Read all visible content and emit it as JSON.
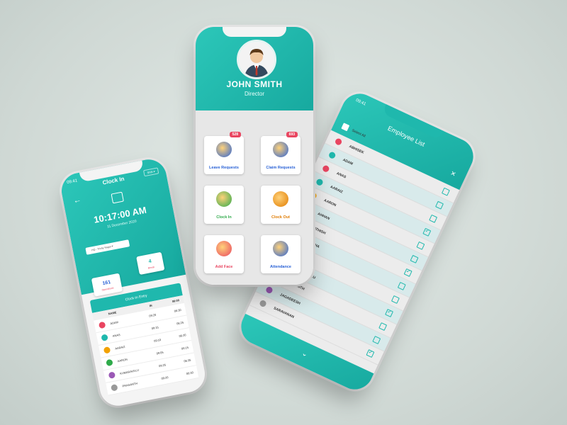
{
  "center_phone": {
    "profile_name": "JOHN SMITH",
    "profile_role": "Director",
    "tiles": [
      {
        "label": "Leave Requests",
        "badge": "528",
        "color": "#2a62d6",
        "icon": "leave-request-icon"
      },
      {
        "label": "Claim Requests",
        "badge": "693",
        "color": "#2a62d6",
        "icon": "claim-request-icon"
      },
      {
        "label": "Clock In",
        "badge": "",
        "color": "#2eaa4a",
        "icon": "clock-in-icon"
      },
      {
        "label": "Clock Out",
        "badge": "",
        "color": "#e07b00",
        "icon": "clock-out-icon"
      },
      {
        "label": "Add Face",
        "badge": "",
        "color": "#e94560",
        "icon": "add-face-icon"
      },
      {
        "label": "Attendance",
        "badge": "",
        "color": "#2a62d6",
        "icon": "attendance-icon"
      }
    ]
  },
  "left_phone": {
    "time": "09:41",
    "title": "Clock In",
    "shift": "Shift ▾",
    "clock": "10:17:00 AM",
    "date": "11 December 2020",
    "location": "HQ - Trichy Nagar ▾",
    "stats": [
      {
        "value": "161",
        "label": "Operations",
        "color": "#2a62d6"
      },
      {
        "value": "4",
        "label": "Break",
        "color": "#1fb8ad"
      }
    ],
    "table_title": "Clock-In Entry",
    "columns": [
      "",
      "NAME",
      "IN",
      "06:00"
    ],
    "rows": [
      {
        "name": "ADAM",
        "in": "09:20",
        "out": "06:30",
        "color": "#e94560"
      },
      {
        "name": "ANAS",
        "in": "09:15",
        "out": "06:25",
        "color": "#1fb8ad"
      },
      {
        "name": "AARAIZ",
        "in": "09:10",
        "out": "06:20",
        "color": "#f2a100"
      },
      {
        "name": "AARON",
        "in": "09:05",
        "out": "06:15",
        "color": "#2eaa4a"
      },
      {
        "name": "KUMARAVELU",
        "in": "09:25",
        "out": "06:35",
        "color": "#9b59b6"
      },
      {
        "name": "PRASANTH",
        "in": "09:20",
        "out": "06:30",
        "color": "#999999"
      }
    ]
  },
  "right_phone": {
    "time": "09:41",
    "title": "Employee List",
    "select_all": "Select All",
    "close": "✕",
    "employees": [
      {
        "name": "ABHISEK",
        "checked": false,
        "color": "#e94560"
      },
      {
        "name": "ADAM",
        "checked": false,
        "color": "#1fb8ad"
      },
      {
        "name": "ANAS",
        "checked": false,
        "color": "#e94560"
      },
      {
        "name": "AARAIZ",
        "checked": true,
        "color": "#1fb8ad"
      },
      {
        "name": "AARON",
        "checked": false,
        "color": "#f2a100"
      },
      {
        "name": "AHHAN",
        "checked": false,
        "color": "#2eaa4a"
      },
      {
        "name": "SATHISH",
        "checked": true,
        "color": "#e94560"
      },
      {
        "name": "NIVETHA",
        "checked": false,
        "color": "#1fb8ad"
      },
      {
        "name": "ABIRAMI",
        "checked": false,
        "color": "#9b59b6"
      },
      {
        "name": "KUMARAVELU",
        "checked": true,
        "color": "#e94560"
      },
      {
        "name": "PRASANTH",
        "checked": false,
        "color": "#2eaa4a"
      },
      {
        "name": "JAGADEESH",
        "checked": false,
        "color": "#9b59b6"
      },
      {
        "name": "SARAVANAN",
        "checked": true,
        "color": "#999999"
      }
    ],
    "footer_icon": "arrow-down-icon"
  }
}
